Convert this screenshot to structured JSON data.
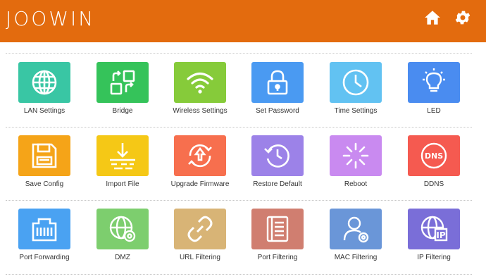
{
  "header": {
    "logo_text": "JOOWIN",
    "home_icon": "home-icon",
    "settings_icon": "gear-icon",
    "background": "#e36b0e"
  },
  "rows": [
    {
      "tiles": [
        {
          "label": "LAN Settings",
          "icon": "globe-icon",
          "color": "#39c6a4"
        },
        {
          "label": "Bridge",
          "icon": "bridge-icon",
          "color": "#35c35a"
        },
        {
          "label": "Wireless Settings",
          "icon": "wifi-icon",
          "color": "#86cb3a"
        },
        {
          "label": "Set Password",
          "icon": "lock-icon",
          "color": "#4a9af2"
        },
        {
          "label": "Time Settings",
          "icon": "clock-icon",
          "color": "#62c2f2"
        },
        {
          "label": "LED",
          "icon": "bulb-icon",
          "color": "#4a8cf0"
        }
      ]
    },
    {
      "tiles": [
        {
          "label": "Save Config",
          "icon": "floppy-icon",
          "color": "#f5a418"
        },
        {
          "label": "Import File",
          "icon": "import-icon",
          "color": "#f5c816"
        },
        {
          "label": "Upgrade Firmware",
          "icon": "upgrade-icon",
          "color": "#f76f4e"
        },
        {
          "label": "Restore Default",
          "icon": "restore-icon",
          "color": "#9c82e8"
        },
        {
          "label": "Reboot",
          "icon": "reboot-icon",
          "color": "#c98af0"
        },
        {
          "label": "DDNS",
          "icon": "dns-icon",
          "color": "#f55a50"
        }
      ]
    },
    {
      "tiles": [
        {
          "label": "Port Forwarding",
          "icon": "router-port-icon",
          "color": "#4aa2f2"
        },
        {
          "label": "DMZ",
          "icon": "globe-gear-icon",
          "color": "#7dce6e"
        },
        {
          "label": "URL Filtering",
          "icon": "link-icon",
          "color": "#d8b476"
        },
        {
          "label": "Port Filtering",
          "icon": "document-icon",
          "color": "#d07e70"
        },
        {
          "label": "MAC Filtering",
          "icon": "user-gear-icon",
          "color": "#6a96d8"
        },
        {
          "label": "IP Filtering",
          "icon": "globe-ip-icon",
          "color": "#7a6ed8"
        }
      ]
    }
  ]
}
